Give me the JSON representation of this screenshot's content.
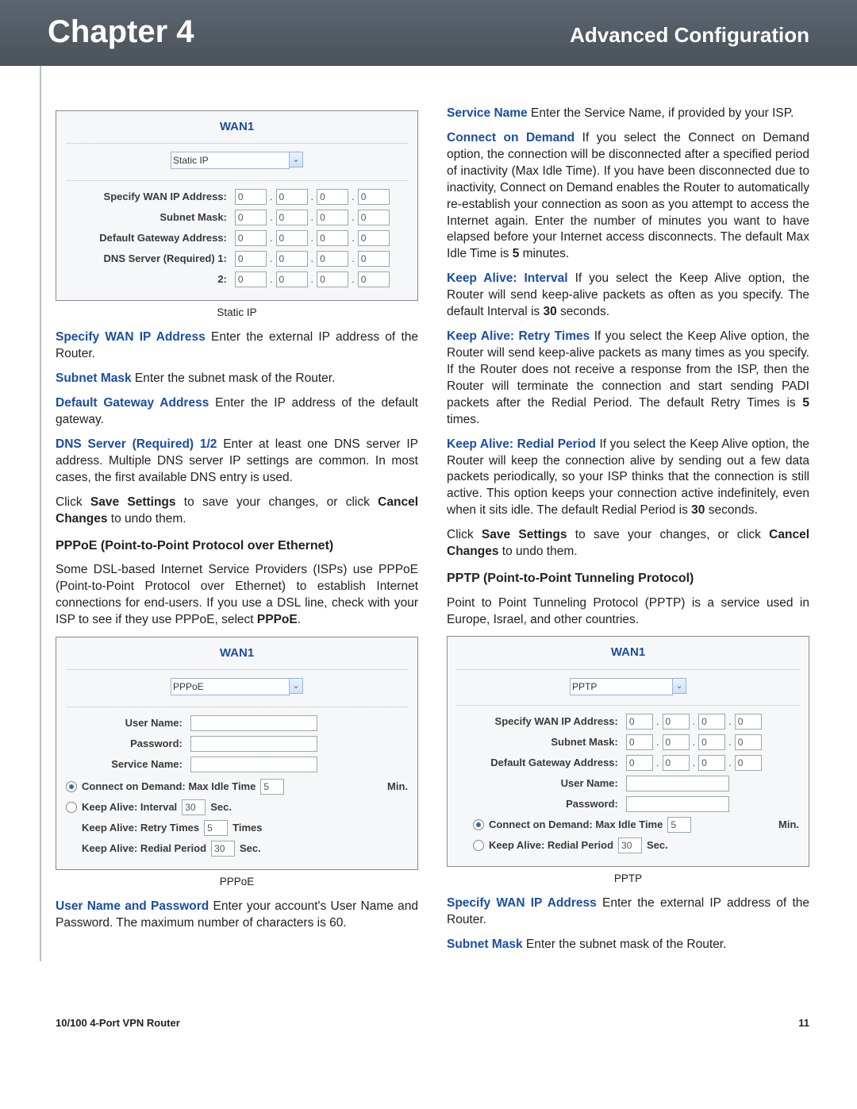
{
  "header": {
    "chapter": "Chapter 4",
    "subtitle": "Advanced Configuration"
  },
  "footer": {
    "product": "10/100 4-Port VPN Router",
    "page": "11"
  },
  "figs": {
    "static": {
      "title": "WAN1",
      "dropdown": "Static IP",
      "rows": {
        "specify": "Specify WAN IP Address:",
        "subnet": "Subnet Mask:",
        "gateway": "Default Gateway Address:",
        "dns1": "DNS Server (Required) 1:",
        "dns2": "2:"
      },
      "octet": "0",
      "caption": "Static IP"
    },
    "pppoe": {
      "title": "WAN1",
      "dropdown": "PPPoE",
      "user": "User Name:",
      "pass": "Password:",
      "service": "Service Name:",
      "cod": "Connect on Demand: Max Idle Time",
      "cod_val": "5",
      "cod_unit": "Min.",
      "ka_int": "Keep Alive: Interval",
      "ka_int_val": "30",
      "ka_int_unit": "Sec.",
      "ka_retry": "Keep Alive: Retry Times",
      "ka_retry_val": "5",
      "ka_retry_unit": "Times",
      "ka_redial": "Keep Alive: Redial Period",
      "ka_redial_val": "30",
      "ka_redial_unit": "Sec.",
      "caption": "PPPoE"
    },
    "pptp": {
      "title": "WAN1",
      "dropdown": "PPTP",
      "specify": "Specify WAN IP Address:",
      "subnet": "Subnet Mask:",
      "gateway": "Default Gateway Address:",
      "user": "User Name:",
      "pass": "Password:",
      "cod": "Connect on Demand: Max Idle Time",
      "cod_val": "5",
      "cod_unit": "Min.",
      "ka_redial": "Keep Alive: Redial Period",
      "ka_redial_val": "30",
      "ka_redial_unit": "Sec.",
      "octet": "0",
      "caption": "PPTP"
    }
  },
  "text": {
    "l1_term": "Specify WAN IP Address",
    "l1_body": "  Enter the external IP address of the Router.",
    "l2_term": "Subnet Mask",
    "l2_body": "  Enter the subnet mask of the Router.",
    "l3_term": "Default Gateway Address",
    "l3_body": "  Enter the IP address of the default gateway.",
    "l4_term": "DNS Server (Required) 1/2",
    "l4_body": "  Enter at least one DNS server IP address. Multiple DNS server IP settings are common. In most cases, the first available DNS entry is used.",
    "l5a": "Click ",
    "l5b": "Save Settings",
    "l5c": " to save your changes, or click ",
    "l5d": "Cancel Changes",
    "l5e": " to undo them.",
    "l6_head": "PPPoE (Point-to-Point Protocol over Ethernet)",
    "l7a": "Some DSL-based Internet Service Providers (ISPs) use PPPoE (Point-to-Point Protocol over Ethernet) to establish Internet connections for end-users. If you use a DSL line, check with your ISP to see if they use PPPoE, select ",
    "l7b": "PPPoE",
    "l7c": ".",
    "l8_term": "User Name and Password",
    "l8_body": "  Enter your account's User Name and Password. The maximum number of characters is 60.",
    "r1_term": "Service Name",
    "r1_body": "  Enter the Service Name, if provided by your ISP.",
    "r2_term": "Connect on Demand",
    "r2_body1": " If you select the Connect on Demand option, the connection will be disconnected after a specified period of inactivity (Max Idle Time). If you have been disconnected due to inactivity, Connect on Demand enables the Router to automatically re-establish your connection as soon as you attempt to access the Internet again. Enter the number of minutes you want to have elapsed before your Internet access disconnects. The default Max Idle Time is ",
    "r2_b": "5",
    "r2_body2": " minutes.",
    "r3_term": "Keep Alive: Interval",
    "r3_body1": "  If you select the Keep Alive option, the Router will send keep-alive packets as often as you specify. The default Interval is ",
    "r3_b": "30",
    "r3_body2": " seconds.",
    "r4_term": "Keep Alive: Retry Times",
    "r4_body1": "  If you select the Keep Alive option, the Router will send keep-alive packets as many times as you specify. If the Router does not receive a response from the ISP, then the Router will terminate the connection and start sending PADI packets after the Redial Period. The default Retry Times is ",
    "r4_b": "5",
    "r4_body2": " times.",
    "r5_term": "Keep Alive: Redial Period",
    "r5_body1": "  If you select the Keep Alive option, the Router will keep the connection alive by sending out a few data packets periodically, so your ISP thinks that the connection is still active. This option keeps your connection active indefinitely, even when it sits idle. The default Redial Period is ",
    "r5_b": "30",
    "r5_body2": " seconds.",
    "r6_head": "PPTP (Point-to-Point Tunneling Protocol)",
    "r7": "Point to Point Tunneling Protocol (PPTP) is a service used in Europe, Israel, and other countries.",
    "r8_term": "Specify WAN IP Address",
    "r8_body": "  Enter the external IP address of the Router.",
    "r9_term": "Subnet Mask",
    "r9_body": "  Enter the subnet mask of the Router."
  }
}
